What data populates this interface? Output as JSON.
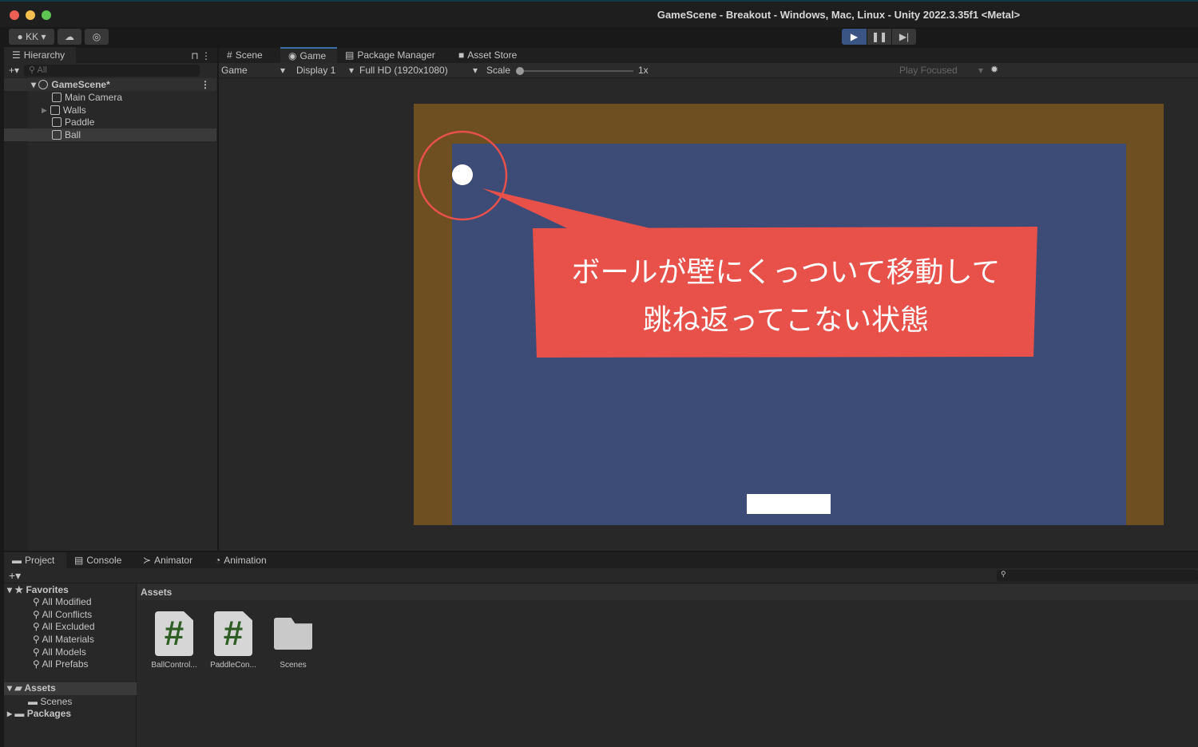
{
  "window": {
    "title": "GameScene - Breakout - Windows, Mac, Linux - Unity 2022.3.35f1 <Metal>"
  },
  "toolbar": {
    "account": "KK",
    "play_icon": "play-icon",
    "pause_icon": "pause-icon",
    "step_icon": "step-icon"
  },
  "hierarchy": {
    "tab": "Hierarchy",
    "search_placeholder": "All",
    "scene": "GameScene*",
    "items": [
      {
        "label": "Main Camera"
      },
      {
        "label": "Walls"
      },
      {
        "label": "Paddle"
      },
      {
        "label": "Ball"
      }
    ]
  },
  "game_tabs": [
    {
      "label": "Scene"
    },
    {
      "label": "Game"
    },
    {
      "label": "Package Manager"
    },
    {
      "label": "Asset Store"
    }
  ],
  "game_toolbar": {
    "mode": "Game",
    "display": "Display 1",
    "resolution": "Full HD (1920x1080)",
    "scale_label": "Scale",
    "scale_value": "1x",
    "play_focused": "Play Focused"
  },
  "game_colors": {
    "wall": "#6e4f22",
    "field": "#3d4b77",
    "ball": "#ffffff",
    "paddle": "#ffffff",
    "annotation": "#e8504a"
  },
  "annotation": {
    "line1": "ボールが壁にくっついて移動して",
    "line2": "跳ね返ってこない状態"
  },
  "bottom_tabs": [
    {
      "label": "Project"
    },
    {
      "label": "Console"
    },
    {
      "label": "Animator"
    },
    {
      "label": "Animation"
    }
  ],
  "project": {
    "favorites_label": "Favorites",
    "favorites": [
      "All Modified",
      "All Conflicts",
      "All Excluded",
      "All Materials",
      "All Models",
      "All Prefabs"
    ],
    "assets_label": "Assets",
    "assets_children": [
      "Scenes"
    ],
    "packages_label": "Packages",
    "breadcrumb": "Assets",
    "files": [
      {
        "name": "BallControl..."
      },
      {
        "name": "PaddleCon..."
      },
      {
        "name": "Scenes"
      }
    ]
  }
}
